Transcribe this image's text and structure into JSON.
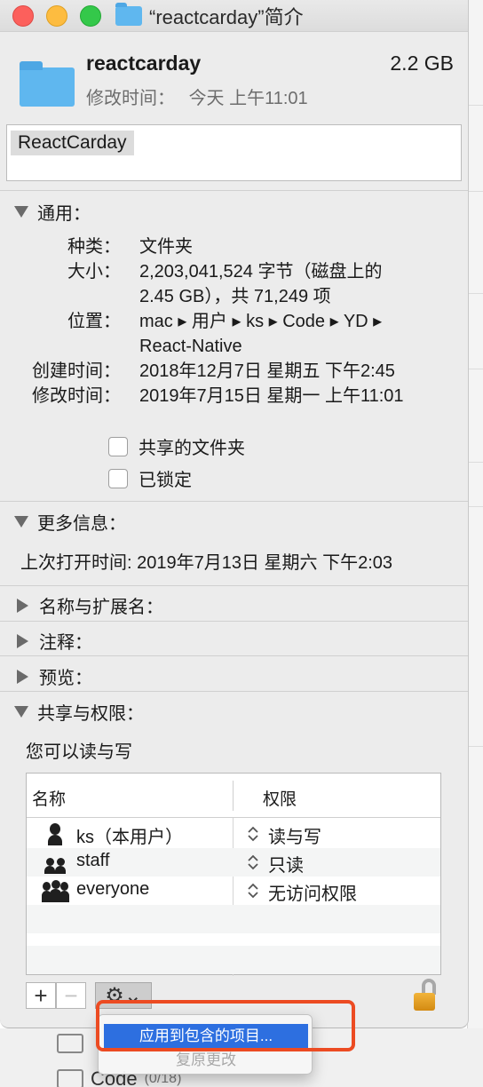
{
  "window": {
    "title": "“reactcarday”简介"
  },
  "header": {
    "name": "reactcarday",
    "size": "2.2 GB",
    "modified_label": "修改时间：",
    "modified_value": "今天 上午11:01"
  },
  "name_field": {
    "value": "ReactCarday"
  },
  "general": {
    "title": "通用：",
    "kind_label": "种类：",
    "kind_value": "文件夹",
    "size_label": "大小：",
    "size_value_line1": "2,203,041,524 字节（磁盘上的",
    "size_value_line2": "2.45 GB），共 71,249 项",
    "where_label": "位置：",
    "where_value_line1": "mac ▸ 用户 ▸ ks ▸ Code ▸ YD ▸",
    "where_value_line2": "React-Native",
    "created_label": "创建时间：",
    "created_value": "2018年12月7日 星期五 下午2:45",
    "modified_label": "修改时间：",
    "modified_value": "2019年7月15日 星期一 上午11:01",
    "shared_folder_label": "共享的文件夹",
    "locked_label": "已锁定"
  },
  "more_info": {
    "title": "更多信息：",
    "last_opened": "上次打开时间: 2019年7月13日 星期六 下午2:03"
  },
  "collapsed_sections": {
    "name_ext": "名称与扩展名：",
    "comments": "注释：",
    "preview": "预览："
  },
  "sharing": {
    "title": "共享与权限：",
    "summary": "您可以读与写",
    "col_name": "名称",
    "col_priv": "权限",
    "rows": [
      {
        "user": "ks（本用户）",
        "privilege": "读与写",
        "icon": "single-user-icon"
      },
      {
        "user": "staff",
        "privilege": "只读",
        "icon": "group-icon"
      },
      {
        "user": "everyone",
        "privilege": "无访问权限",
        "icon": "everyone-icon"
      }
    ],
    "add_symbol": "+",
    "remove_symbol": "−",
    "gear_symbol": "⚙︎⌄"
  },
  "action_menu": {
    "item_apply": "应用到包含的项目...",
    "item_revert": "复原更改"
  },
  "background": {
    "row_text": "Code",
    "row_count": "(0/18)"
  }
}
